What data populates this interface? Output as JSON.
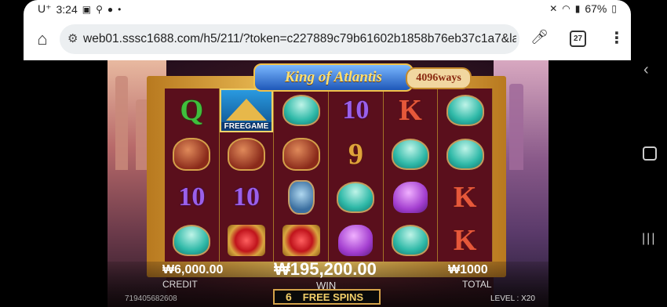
{
  "status_bar": {
    "carrier": "U⁺",
    "time": "3:24",
    "battery": "67%"
  },
  "browser": {
    "url": "web01.sssc1688.com/h5/211/?token=c227889c79b61602b1858b76eb37c1a7&lang",
    "tab_count": "27"
  },
  "game": {
    "title": "King of Atlantis",
    "ways": "4096ways",
    "free_game_label": "FREEGAME",
    "reels": [
      [
        "Q",
        "urn",
        "10",
        "shell"
      ],
      [
        "freegame",
        "urn",
        "10",
        "gem"
      ],
      [
        "shell",
        "urn",
        "bottle",
        "gem"
      ],
      [
        "10",
        "9",
        "shell",
        "horse"
      ],
      [
        "K",
        "shell",
        "horse",
        "shell"
      ],
      [
        "shell",
        "shell",
        "K",
        "K"
      ]
    ],
    "credit": {
      "value": "₩6,000.00",
      "label": "CREDIT"
    },
    "win": {
      "value": "₩195,200.00",
      "label": "WIN"
    },
    "total": {
      "value": "₩1000",
      "label": "TOTAL"
    },
    "free_spins": {
      "count": "6",
      "label": "FREE SPINS"
    },
    "serial": "719405682608",
    "level": "LEVEL : X20"
  }
}
